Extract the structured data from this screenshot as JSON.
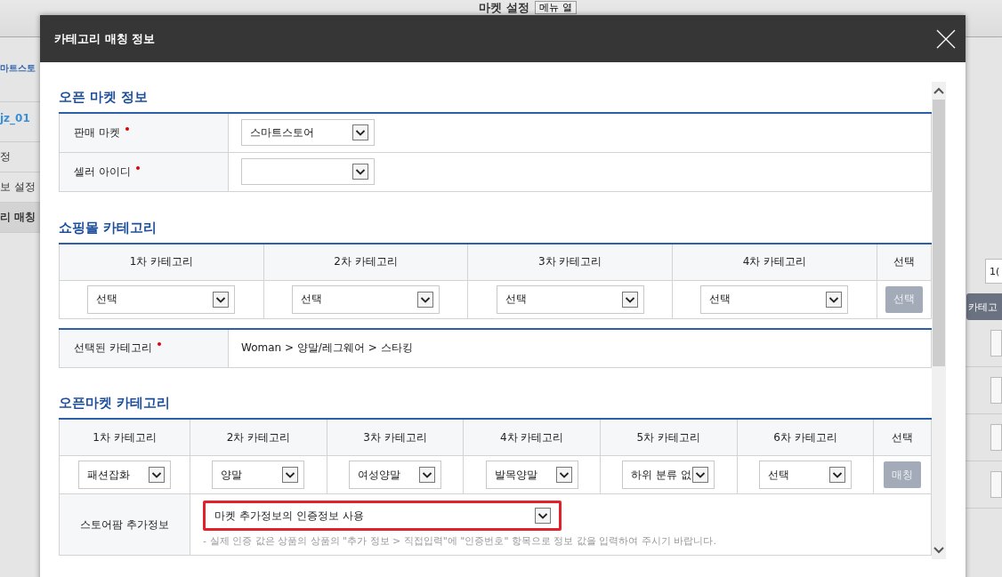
{
  "background": {
    "page_title": "마켓 설정",
    "menu_button": "메뉴 열",
    "sidebar_items": [
      {
        "label": "마트스토",
        "kind": "heading"
      },
      {
        "label": "jz_01",
        "kind": "account"
      },
      {
        "label": "정",
        "kind": "link",
        "selected": false
      },
      {
        "label": "보 설정",
        "kind": "link",
        "selected": false
      },
      {
        "label": "리 매칭",
        "kind": "link",
        "selected": true
      }
    ],
    "right_field": "1(",
    "right_button": "카테고"
  },
  "dialog": {
    "title": "카테고리 매칭 정보",
    "open_market_info": {
      "title": "오픈 마켓 정보",
      "rows": [
        {
          "label": "판매 마켓",
          "required": true,
          "value": "스마트스토어"
        },
        {
          "label": "셀러 아이디",
          "required": true
        }
      ]
    },
    "shopping_category": {
      "title": "쇼핑몰 카테고리",
      "columns": [
        "1차 카테고리",
        "2차 카테고리",
        "3차 카테고리",
        "4차 카테고리",
        "선택"
      ],
      "selects": [
        "선택",
        "선택",
        "선택",
        "선택"
      ],
      "button": {
        "label": "선택",
        "disabled": true
      },
      "selected_category": {
        "label": "선택된 카테고리",
        "required": true,
        "value": "Woman > 양말/레그웨어 > 스타킹"
      }
    },
    "openmarket_category": {
      "title": "오픈마켓 카테고리",
      "columns": [
        "1차 카테고리",
        "2차 카테고리",
        "3차 카테고리",
        "4차 카테고리",
        "5차 카테고리",
        "6차 카테고리",
        "선택"
      ],
      "selects": [
        "패션잡화",
        "양말",
        "여성양말",
        "발목양말",
        "하위 분류 없",
        "선택"
      ],
      "button": {
        "label": "매칭",
        "disabled": true
      },
      "extra_info": {
        "label": "스토어팜 추가정보",
        "value": "마켓 추가정보의 인증정보 사용",
        "highlighted": true,
        "note": "- 실제 인증 값은 상품의 상품의 \"추가 정보 > 직접입력\"에 \"인증번호\" 항목으로 정보 값을 입력하여 주시기 바랍니다."
      }
    }
  }
}
